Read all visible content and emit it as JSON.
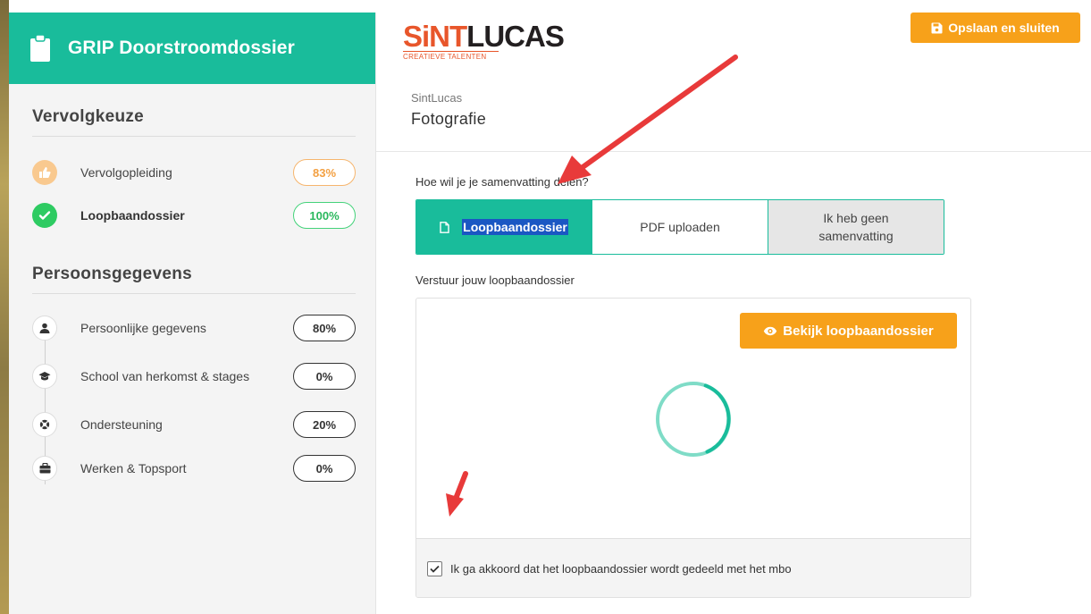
{
  "sidebar": {
    "title": "GRIP Doorstroomdossier",
    "sections": [
      {
        "title": "Vervolgkeuze",
        "items": [
          {
            "label": "Vervolgopleiding",
            "percent": "83%",
            "icon": "thumbs-up-icon"
          },
          {
            "label": "Loopbaandossier",
            "percent": "100%",
            "icon": "check-icon"
          }
        ]
      },
      {
        "title": "Persoonsgegevens",
        "items": [
          {
            "label": "Persoonlijke gegevens",
            "percent": "80%",
            "icon": "user-icon"
          },
          {
            "label": "School van herkomst & stages",
            "percent": "0%",
            "icon": "graduation-cap-icon"
          },
          {
            "label": "Ondersteuning",
            "percent": "20%",
            "icon": "lifebuoy-icon"
          },
          {
            "label": "Werken & Topsport",
            "percent": "0%",
            "icon": "briefcase-icon"
          }
        ]
      }
    ]
  },
  "logo": {
    "brand_a": "SiNT",
    "brand_b": "LUCAS",
    "tagline": "CREATIEVE TALENTEN"
  },
  "header": {
    "save_label": "Opslaan en sluiten",
    "organization": "SintLucas",
    "program": "Fotografie"
  },
  "share": {
    "question": "Hoe wil je je samenvatting delen?",
    "options": [
      {
        "label": "Loopbaandossier",
        "state": "selected"
      },
      {
        "label": "PDF uploaden",
        "state": "default"
      },
      {
        "label": "Ik heb geen samenvatting",
        "state": "disabled"
      }
    ]
  },
  "send": {
    "label": "Verstuur jouw loopbaandossier",
    "view_button": "Bekijk loopbaandossier",
    "agree_text": "Ik ga akkoord dat het loopbaandossier wordt gedeeld met het mbo",
    "agree_checked": true
  },
  "colors": {
    "accent": "#19bc9b",
    "orange": "#f7a11a",
    "annotation": "#e83a3a"
  }
}
